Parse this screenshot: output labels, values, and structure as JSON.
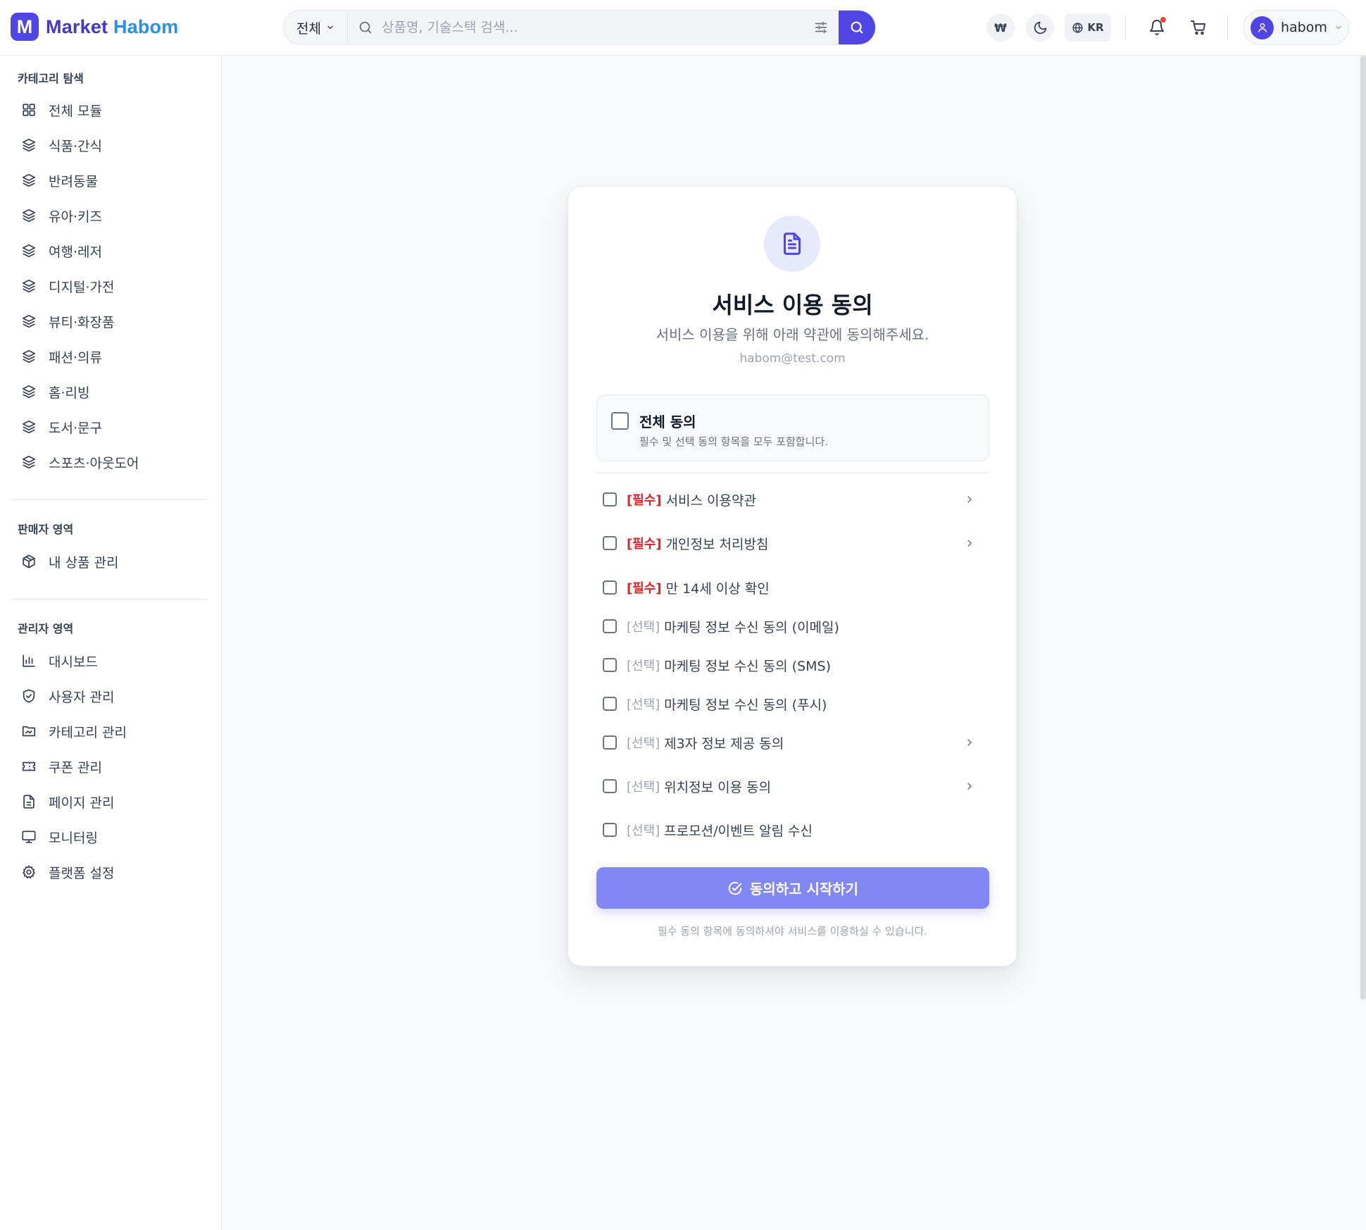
{
  "brand": {
    "logo_letter": "M",
    "name_part1": "Market",
    "name_part2": "Habom",
    "accent": "#4f46e5",
    "accent2": "#2b8ee8"
  },
  "header": {
    "search": {
      "category": "전체",
      "placeholder": "상품명, 기술스택 검색..."
    },
    "currency": "₩",
    "lang": "KR",
    "user_name": "habom",
    "icons": [
      "search-icon",
      "sliders-icon",
      "moon-icon",
      "globe-icon",
      "bell-icon",
      "cart-icon",
      "user-icon",
      "chevron-down-icon"
    ],
    "notification_dot_color": "#ef4444"
  },
  "sidebar": {
    "category_title": "카테고리 탐색",
    "categories": [
      {
        "label": "전체 모듈",
        "icon": "grid-icon"
      },
      {
        "label": "식품·간식",
        "icon": "layers-icon"
      },
      {
        "label": "반려동물",
        "icon": "layers-icon"
      },
      {
        "label": "유아·키즈",
        "icon": "layers-icon"
      },
      {
        "label": "여행·레저",
        "icon": "layers-icon"
      },
      {
        "label": "디지털·가전",
        "icon": "layers-icon"
      },
      {
        "label": "뷰티·화장품",
        "icon": "layers-icon"
      },
      {
        "label": "패션·의류",
        "icon": "layers-icon"
      },
      {
        "label": "홈·리빙",
        "icon": "layers-icon"
      },
      {
        "label": "도서·문구",
        "icon": "layers-icon"
      },
      {
        "label": "스포츠·아웃도어",
        "icon": "layers-icon"
      }
    ],
    "seller_title": "판매자 영역",
    "seller_items": [
      {
        "label": "내 상품 관리",
        "icon": "package-icon"
      }
    ],
    "admin_title": "관리자 영역",
    "admin_items": [
      {
        "label": "대시보드",
        "icon": "bar-chart-icon"
      },
      {
        "label": "사용자 관리",
        "icon": "shield-icon"
      },
      {
        "label": "카테고리 관리",
        "icon": "folder-icon"
      },
      {
        "label": "쿠폰 관리",
        "icon": "ticket-icon"
      },
      {
        "label": "페이지 관리",
        "icon": "file-icon"
      },
      {
        "label": "모니터링",
        "icon": "monitor-icon"
      },
      {
        "label": "플랫폼 설정",
        "icon": "gear-icon"
      }
    ]
  },
  "consent": {
    "title": "서비스 이용 동의",
    "subtitle": "서비스 이용을 위해 아래 약관에 동의해주세요.",
    "email": "habom@test.com",
    "all": {
      "title": "전체 동의",
      "desc": "필수 및 선택 동의 항목을 모두 포함합니다.",
      "checked": false
    },
    "items": [
      {
        "tag": "[필수]",
        "required": true,
        "label": "서비스 이용약관",
        "has_detail": true,
        "checked": false
      },
      {
        "tag": "[필수]",
        "required": true,
        "label": "개인정보 처리방침",
        "has_detail": true,
        "checked": false
      },
      {
        "tag": "[필수]",
        "required": true,
        "label": "만 14세 이상 확인",
        "has_detail": false,
        "checked": false
      },
      {
        "tag": "[선택]",
        "required": false,
        "label": "마케팅 정보 수신 동의 (이메일)",
        "has_detail": false,
        "checked": false
      },
      {
        "tag": "[선택]",
        "required": false,
        "label": "마케팅 정보 수신 동의 (SMS)",
        "has_detail": false,
        "checked": false
      },
      {
        "tag": "[선택]",
        "required": false,
        "label": "마케팅 정보 수신 동의 (푸시)",
        "has_detail": false,
        "checked": false
      },
      {
        "tag": "[선택]",
        "required": false,
        "label": "제3자 정보 제공 동의",
        "has_detail": true,
        "checked": false
      },
      {
        "tag": "[선택]",
        "required": false,
        "label": "위치정보 이용 동의",
        "has_detail": true,
        "checked": false
      },
      {
        "tag": "[선택]",
        "required": false,
        "label": "프로모션/이벤트 알림 수신",
        "has_detail": false,
        "checked": false
      }
    ],
    "submit_label": "동의하고 시작하기",
    "notice": "필수 동의 항목에 동의하셔야 서비스를 이용하실 수 있습니다."
  }
}
